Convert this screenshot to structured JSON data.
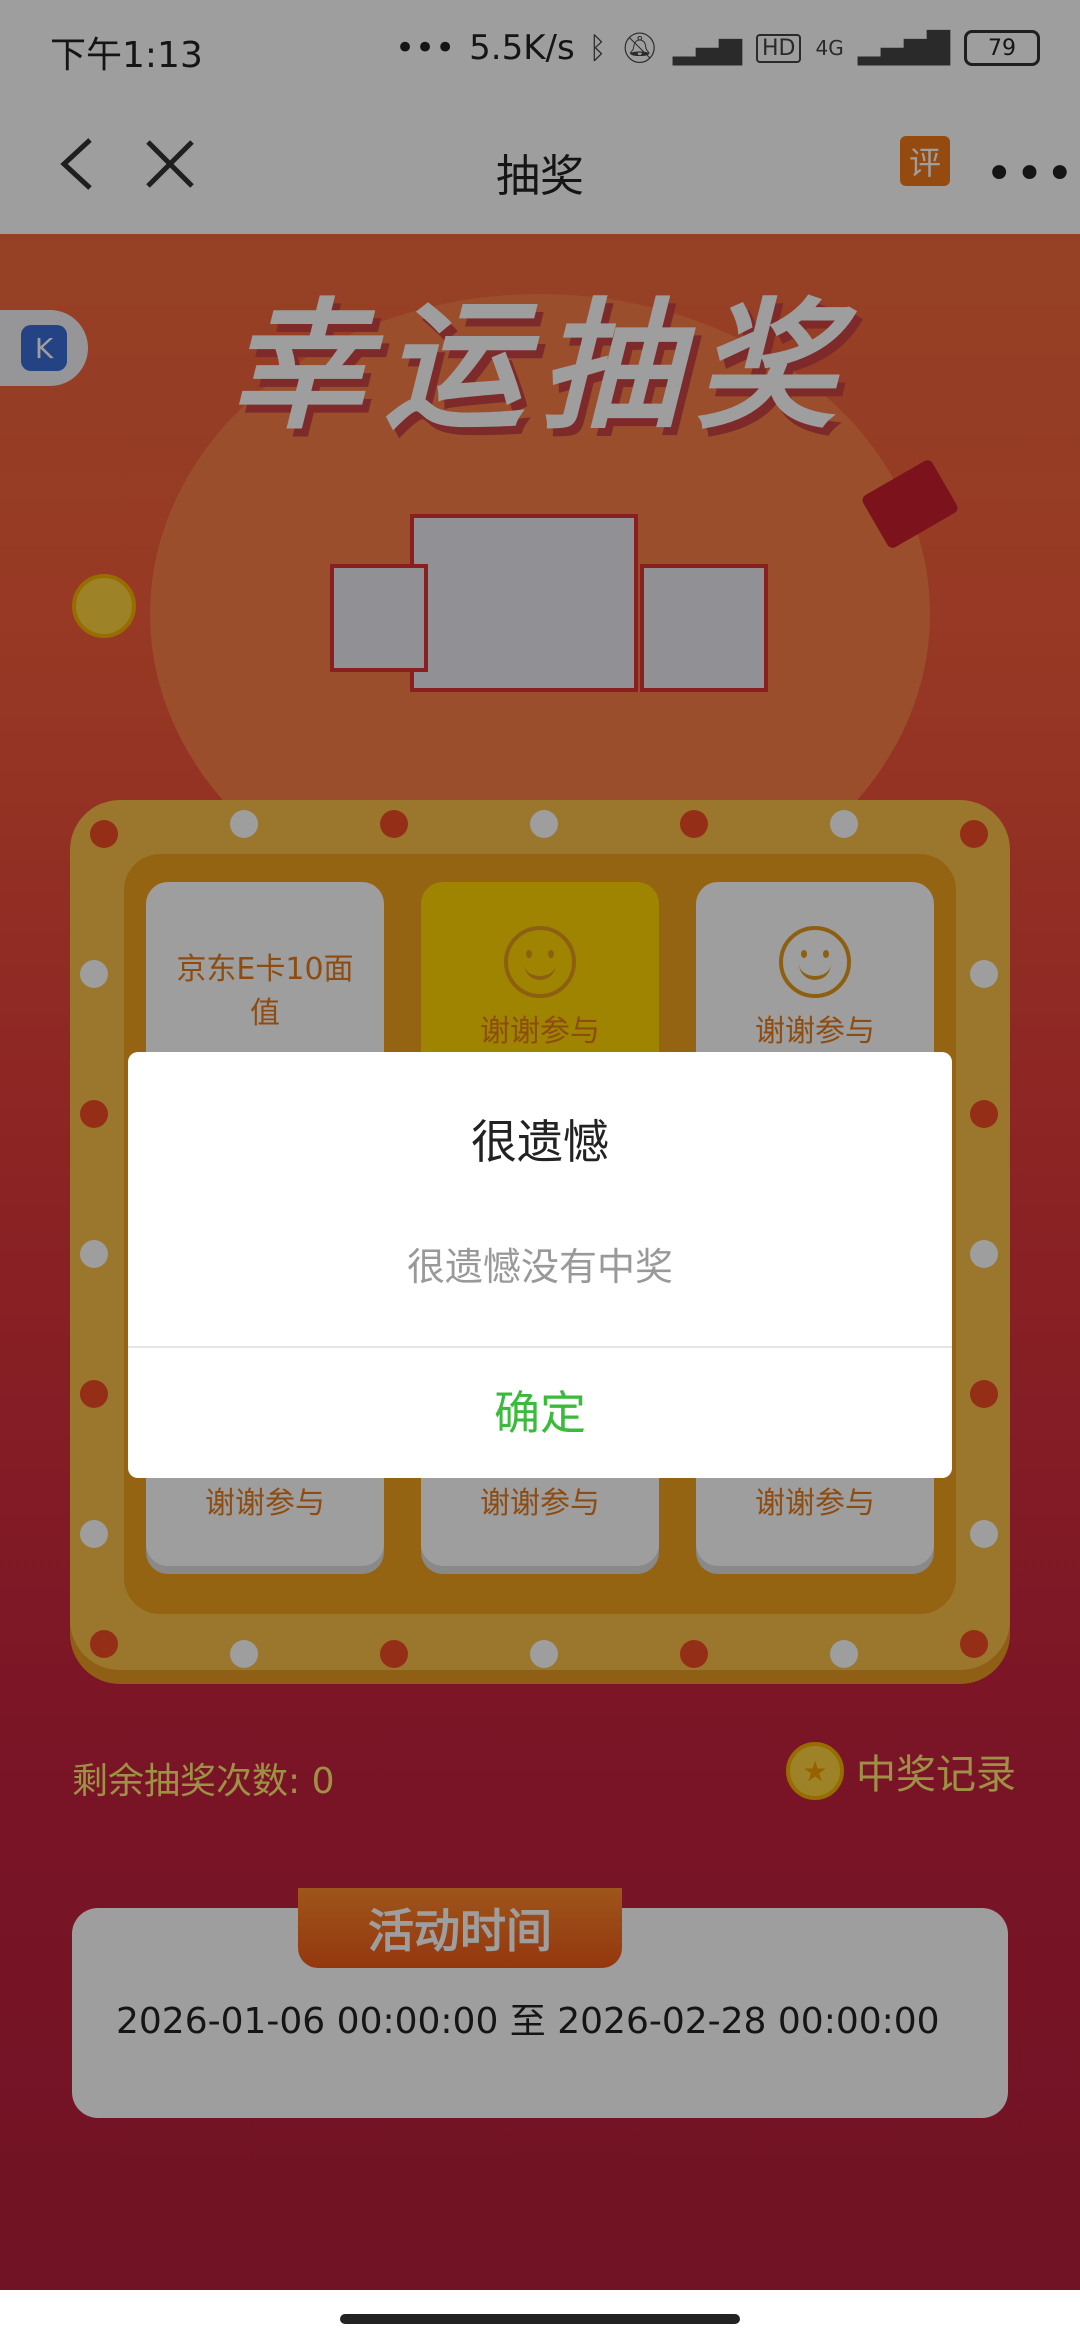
{
  "status_bar": {
    "time": "下午1:13",
    "network_speed": "5.5K/s",
    "battery": "79",
    "signal_label": "4G"
  },
  "nav": {
    "title": "抽奖",
    "rate_icon_text": "评"
  },
  "banner": {
    "title": "幸运抽奖"
  },
  "grid": {
    "cells": [
      {
        "label": "京东E卡10面值",
        "icon": "gift-card"
      },
      {
        "label": "谢谢参与",
        "icon": "smile-icon"
      },
      {
        "label": "谢谢参与",
        "icon": "smile-icon"
      },
      {
        "label": "谢谢参与",
        "icon": "smile-icon"
      },
      {
        "label": "谢谢参与",
        "icon": "smile-icon"
      },
      {
        "label": "谢谢参与",
        "icon": "smile-icon"
      }
    ]
  },
  "remain": {
    "label": "剩余抽奖次数: 0"
  },
  "record": {
    "label": "中奖记录"
  },
  "activity": {
    "title": "活动时间",
    "range": "2026-01-06 00:00:00  至  2026-02-28 00:00:00"
  },
  "dialog": {
    "title": "很遗憾",
    "message": "很遗憾没有中奖",
    "confirm": "确定"
  },
  "colors": {
    "accent_green": "#3bbb3b",
    "orange": "#f07a1a"
  }
}
